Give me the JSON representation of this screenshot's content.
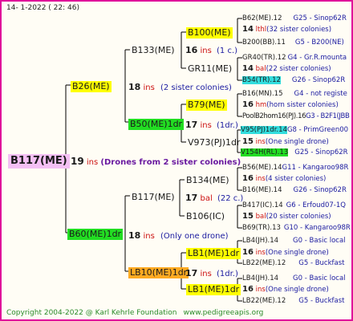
{
  "header": {
    "date": "14-  1-2022 (  22:  46)"
  },
  "root": {
    "name": "B117(ME)",
    "num": "19",
    "unit": "ins",
    "note": "(Drones from 2 sister colonies)"
  },
  "dam": {
    "name": "B26(ME)",
    "num": "18",
    "unit": "ins",
    "note": "(2 sister colonies)"
  },
  "sire": {
    "name": "B60(ME)1dr",
    "num": "18",
    "unit": "ins",
    "note": "(Only one drone)"
  },
  "g3": {
    "b133": {
      "name": "B133(ME)",
      "num": "16",
      "unit": "ins",
      "note": "(1 c.)"
    },
    "b50": {
      "name": "B50(ME)1dr",
      "num": "17",
      "unit": "ins",
      "note": "(1dr.)"
    },
    "b117": {
      "name": "B117(ME)",
      "num": "17",
      "unit": "bal",
      "note": "(22 c.)"
    },
    "lb10": {
      "name": "LB10(ME)1dr",
      "num": "17",
      "unit": "ins",
      "note": "(1dr.)"
    }
  },
  "g4": {
    "b100": {
      "name": "B100(ME)"
    },
    "gr11": {
      "name": "GR11(ME)"
    },
    "b79": {
      "name": "B79(ME)"
    },
    "v973": {
      "name": "V973(PJ)1dr"
    },
    "b134": {
      "name": "B134(ME)",
      "num": "16",
      "unit": "ins",
      "note": "(4 sister colonies)"
    },
    "b106": {
      "name": "B106(IC)",
      "num": "15",
      "unit": "bal",
      "note": "(20 sister colonies)"
    },
    "lb1a": {
      "name": "LB1(ME)1dr",
      "num": "16",
      "unit": "ins",
      "note": "(One single drone)"
    },
    "lb1b": {
      "name": "LB1(ME)1dr",
      "num": "16",
      "unit": "ins",
      "note": "(One single drone)"
    }
  },
  "g5": [
    {
      "left": "B62(ME).12",
      "right": "G25 - Sinop62R"
    },
    {
      "num": "14",
      "unit": "lthl",
      "note": "(32 sister colonies)"
    },
    {
      "left": "B200(BB).11",
      "right": "G5 - B200(NE)"
    },
    {
      "left": "GR40(TR).12",
      "right": "G4 - Gr.R.mounta"
    },
    {
      "num": "14",
      "unit": "bal",
      "note": "(22 sister colonies)"
    },
    {
      "left": "B54(TR).12",
      "right": "G26 - Sinop62R"
    },
    {
      "left": "B16(MN).15",
      "right": "G4 - not registe"
    },
    {
      "num": "16",
      "unit": "hm",
      "note": "(horn sister colonies)"
    },
    {
      "left": "PoolB2hom16(PJ).16",
      "right": "G3 - B2F1(JBB"
    },
    {
      "left": "V95(PJ)1dr.14",
      "right": "G8 - PrimGreen00"
    },
    {
      "num": "15",
      "unit": "ins",
      "note": "(One single drone)"
    },
    {
      "left": "V154H(RL).13",
      "right": "G25 - Sinop62R"
    },
    {
      "left": "B56(ME).14",
      "right": "G11 - Kangaroo98R"
    },
    {
      "left": "B16(ME).14",
      "right": "G26 - Sinop62R"
    },
    {
      "left": "B417(IC).14",
      "right": "G6 - Erfoud07-1Q"
    },
    {
      "left": "B69(TR).13",
      "right": "G10 - Kangaroo98R"
    },
    {
      "left": "LB4(JH).14",
      "right": "G0 - Basic local"
    },
    {
      "left": "LB22(ME).12",
      "right": "G5 - Buckfast"
    },
    {
      "left": "LB4(JH).14",
      "right": "G0 - Basic local"
    },
    {
      "left": "LB22(ME).12",
      "right": "G5 - Buckfast"
    }
  ],
  "footer": {
    "copyright": "Copyright 2004-2022 @ Karl Kehrle Foundation",
    "url": "www.pedigreeapis.org"
  },
  "colors": {
    "border": "#e0109a",
    "yellow": "#ffff00",
    "green": "#22dd22",
    "cyan": "#33dddd",
    "pink": "#f4c0f4",
    "orange": "#ffaa22"
  }
}
